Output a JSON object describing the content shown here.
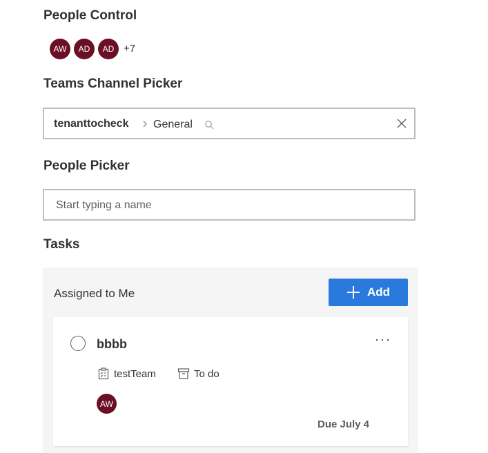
{
  "people_control": {
    "heading": "People Control",
    "avatars": [
      "AW",
      "AD",
      "AD"
    ],
    "more_count": "+7"
  },
  "channel_picker": {
    "heading": "Teams Channel Picker",
    "team": "tenanttocheck",
    "channel": "General",
    "icons": {
      "separator": "chevron-right-icon",
      "search": "search-icon",
      "clear": "close-icon"
    }
  },
  "people_picker": {
    "heading": "People Picker",
    "placeholder": "Start typing a name"
  },
  "tasks": {
    "heading": "Tasks",
    "group_label": "Assigned to Me",
    "add_label": "Add",
    "accent": "#2a7ade",
    "avatar_color": "#6b0f24",
    "items": [
      {
        "title": "bbbb",
        "plan": "testTeam",
        "bucket": "To do",
        "assignee": "AW",
        "due": "Due July 4"
      }
    ]
  }
}
